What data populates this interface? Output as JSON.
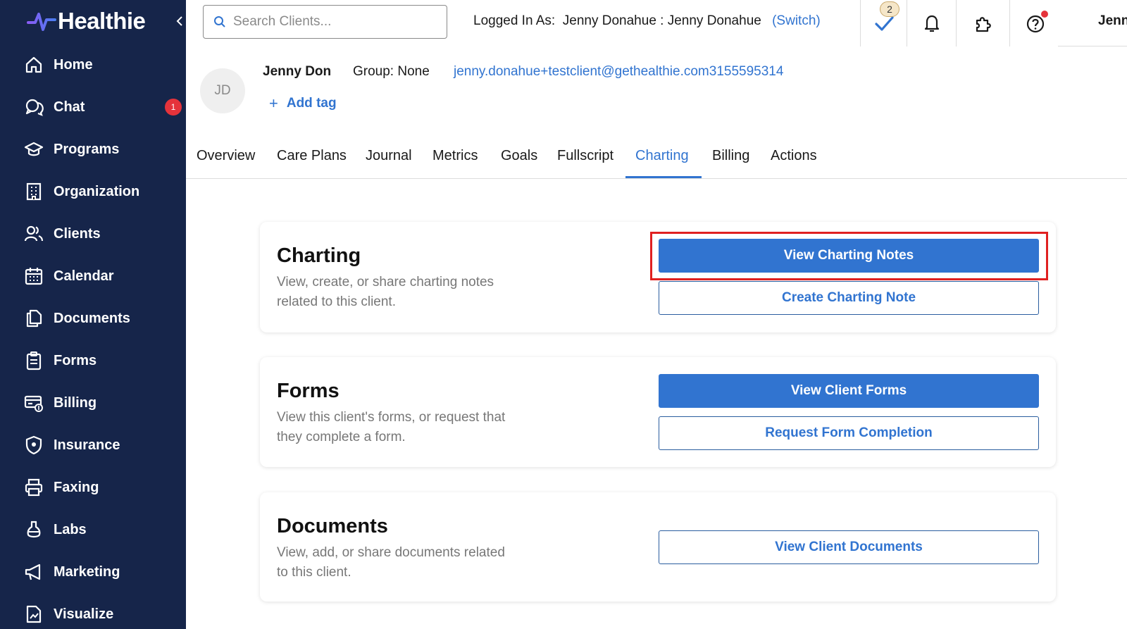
{
  "app": {
    "logo_text": "Healthie"
  },
  "sidebar": {
    "items": [
      {
        "label": "Home",
        "icon": "home-icon"
      },
      {
        "label": "Chat",
        "icon": "chat-icon",
        "badge": "1"
      },
      {
        "label": "Programs",
        "icon": "graduation-cap-icon"
      },
      {
        "label": "Organization",
        "icon": "building-icon"
      },
      {
        "label": "Clients",
        "icon": "users-icon"
      },
      {
        "label": "Calendar",
        "icon": "calendar-icon"
      },
      {
        "label": "Documents",
        "icon": "documents-icon"
      },
      {
        "label": "Forms",
        "icon": "clipboard-icon"
      },
      {
        "label": "Billing",
        "icon": "billing-icon"
      },
      {
        "label": "Insurance",
        "icon": "shield-icon"
      },
      {
        "label": "Faxing",
        "icon": "printer-icon"
      },
      {
        "label": "Labs",
        "icon": "flask-icon"
      },
      {
        "label": "Marketing",
        "icon": "megaphone-icon"
      },
      {
        "label": "Visualize",
        "icon": "chart-document-icon"
      }
    ]
  },
  "header": {
    "search_placeholder": "Search Clients...",
    "logged_in_label": "Logged In As:",
    "logged_in_user": "Jenny Donahue : Jenny Donahue",
    "switch_label": "(Switch)",
    "tasks_badge": "2",
    "user_short": "Jenn"
  },
  "client": {
    "initials": "JD",
    "name": "Jenny Don",
    "group": "Group: None",
    "contact": "jenny.donahue+testclient@gethealthie.com3155595314",
    "add_tag_label": "Add tag",
    "add_tag_plus": "+"
  },
  "tabs": [
    "Overview",
    "Care Plans",
    "Journal",
    "Metrics",
    "Goals",
    "Fullscript",
    "Charting",
    "Billing",
    "Actions"
  ],
  "active_tab": "Charting",
  "cards": {
    "charting": {
      "title": "Charting",
      "description": "View, create, or share charting notes related to this client.",
      "primary_button": "View Charting Notes",
      "secondary_button": "Create Charting Note"
    },
    "forms": {
      "title": "Forms",
      "description": "View this client's forms, or request that they complete a form.",
      "primary_button": "View Client Forms",
      "secondary_button": "Request Form Completion"
    },
    "documents": {
      "title": "Documents",
      "description": "View, add, or share documents related to this client.",
      "secondary_button": "View Client Documents"
    }
  },
  "colors": {
    "sidebar_bg": "#16254a",
    "accent": "#3174d0",
    "badge_red": "#e5333b",
    "highlight_red": "#e02020"
  }
}
